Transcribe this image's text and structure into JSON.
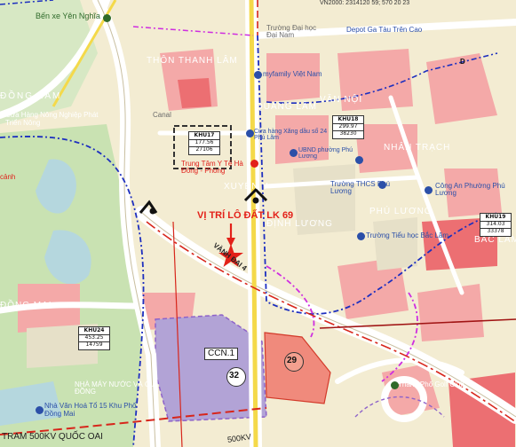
{
  "top_label": "VN2000: 2314120 59; 570 20 23",
  "places": {
    "ben_xe": "Bến xe Yên Nghĩa",
    "thon_thanh_lam": "THÔN THANH LÂM",
    "truong_dh": "Trường Đại học Đại Nam",
    "depot": "Depot Ga Tàu Trên Cao",
    "dong_lam": "ĐỒNG LÂM",
    "vinmart": "myfamily Việt Nam",
    "quang_lam": "QUANG LÂM",
    "van_noi": "VĂN NỘI",
    "cua_hang_nn": "Cửa Hàng Nông Nghiệp Phát Triển Nông",
    "cay_xang": "Cửa hàng Xăng dầu số 24 Phú Lãm",
    "nhan_trach": "NHÂN TRẠCH",
    "canal": "Canal",
    "ubnd": "UBND phường Phú Lương",
    "trung_tam_yte": "Trung Tâm Y Tế Hà Đông - Phòng",
    "canh": "cảnh",
    "truong_thcs": "Trường THCS Phú Lương",
    "cong_an": "Công An Phường Phú Lương",
    "xuyen_y": "XUYÊN Y",
    "dinh_luong": "ĐỊNH LƯƠNG",
    "phu_luong": "PHÚ LƯƠNG",
    "tieu_hoc": "Trường Tiểu học Bắc Lãm",
    "bac_lam": "BẮC LÃM",
    "dong_mai": "ĐỒNG MAI",
    "nha_may": "NHÀ MÁY NƯỚC VÀ GIA ĐỒNG",
    "nha_van_hoa": "Nhà Văn Hoá Tổ 15 Khu Phố Đồng Mai",
    "club": "Thành Phố Golf Club",
    "tram": "TRAM 500KV QUỐC OAI",
    "line_500kv": "500KV",
    "vanh_dai": "VÀNH ĐAI 4"
  },
  "target": {
    "title": "VỊ TRÍ LÔ ĐẤT LK 69",
    "color": "#e32119"
  },
  "zones": [
    {
      "name": "KHU17",
      "area": "177.56",
      "pop": "27106"
    },
    {
      "name": "KHU18",
      "area": "299.97",
      "pop": "38230"
    },
    {
      "name": "KHU19",
      "area": "314.03",
      "pop": "33378"
    },
    {
      "name": "KHU24",
      "area": "453.25",
      "pop": "14759"
    }
  ],
  "markers": {
    "ccn": "CCN.1",
    "n29": "29",
    "n32": "32",
    "d": "D"
  },
  "colors": {
    "background": "#f3ecd2",
    "residential_pink": "#f4a9a8",
    "residential_dark": "#ec6f72",
    "green_space": "#c9e2b2",
    "water": "#b5d7de",
    "road": "#ffffff",
    "boundary_blue": "#1d2fbf",
    "boundary_magenta": "#cf2de0",
    "highlight_red": "#e32119",
    "industrial_purple": "#b2a3d6"
  }
}
